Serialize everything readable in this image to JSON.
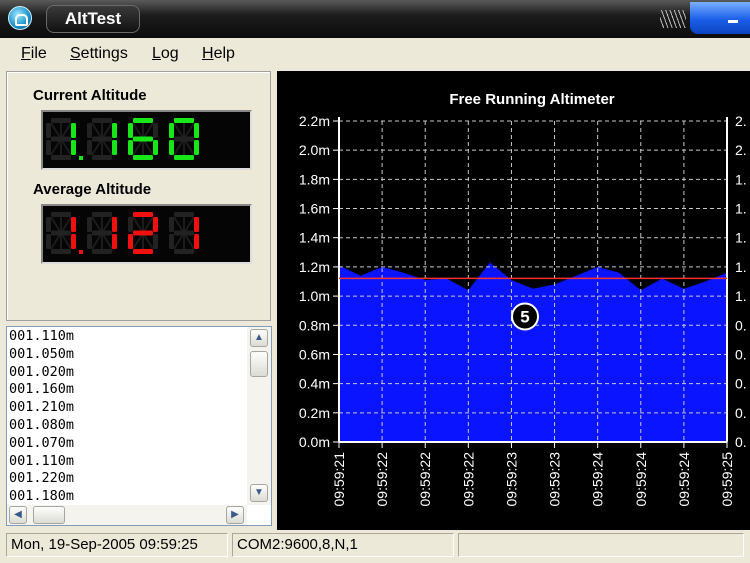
{
  "window": {
    "title": "AltTest"
  },
  "menu": [
    {
      "label": "File",
      "key": "F",
      "rest": "ile"
    },
    {
      "label": "Settings",
      "key": "S",
      "rest": "ettings"
    },
    {
      "label": "Log",
      "key": "L",
      "rest": "og"
    },
    {
      "label": "Help",
      "key": "H",
      "rest": "elp"
    }
  ],
  "current_altitude": {
    "label": "Current Altitude",
    "value": "1.160",
    "color": "#19e619"
  },
  "average_altitude": {
    "label": "Average Altitude",
    "value": "1.121",
    "color": "#f01010"
  },
  "log": {
    "items": [
      "001.110m",
      "001.050m",
      "001.020m",
      "001.160m",
      "001.210m",
      "001.080m",
      "001.070m",
      "001.110m",
      "001.220m",
      "001.180m"
    ]
  },
  "status": {
    "datetime": "Mon, 19-Sep-2005 09:59:25",
    "port": "COM2:9600,8,N,1",
    "extra": ""
  },
  "chart_data": {
    "type": "area",
    "title": "Free Running Altimeter",
    "marker": "5",
    "yunit": "m",
    "ylim": [
      0,
      2.2
    ],
    "yticks": [
      "0.0m",
      "0.2m",
      "0.4m",
      "0.6m",
      "0.8m",
      "1.0m",
      "1.2m",
      "1.4m",
      "1.6m",
      "1.8m",
      "2.0m",
      "2.2m"
    ],
    "right_ticks": [
      "0.",
      "0.",
      "0.",
      "0.",
      "0.",
      "1.",
      "1.",
      "1.",
      "1.",
      "1.",
      "2.",
      "2."
    ],
    "xticks": [
      "09:59:21",
      "09:59:22",
      "09:59:22",
      "09:59:22",
      "09:59:23",
      "09:59:23",
      "09:59:24",
      "09:59:24",
      "09:59:24",
      "09:59:25"
    ],
    "values": [
      1.21,
      1.14,
      1.2,
      1.16,
      1.11,
      1.12,
      1.04,
      1.23,
      1.11,
      1.05,
      1.08,
      1.14,
      1.2,
      1.16,
      1.04,
      1.12,
      1.05,
      1.1,
      1.16
    ],
    "average_line": 1.121,
    "fill_color": "#0a14ff",
    "average_color": "#ff3030",
    "grid": true
  }
}
